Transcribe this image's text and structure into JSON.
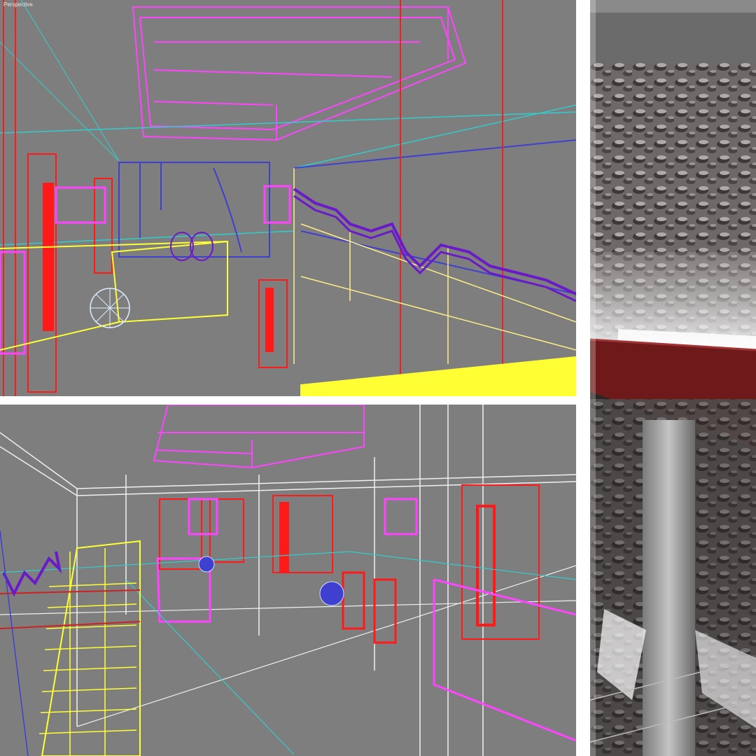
{
  "viewports": {
    "top_label": "Perspective",
    "bottom_label": ""
  },
  "colors": {
    "viewport_bg": "#7e7e7e",
    "magenta": "#ff3cff",
    "red": "#ff1a1a",
    "yellow": "#ffff33",
    "cyan": "#33cccc",
    "blue": "#4040d0",
    "purple": "#6a1ac8",
    "white": "#f0f0f0"
  }
}
